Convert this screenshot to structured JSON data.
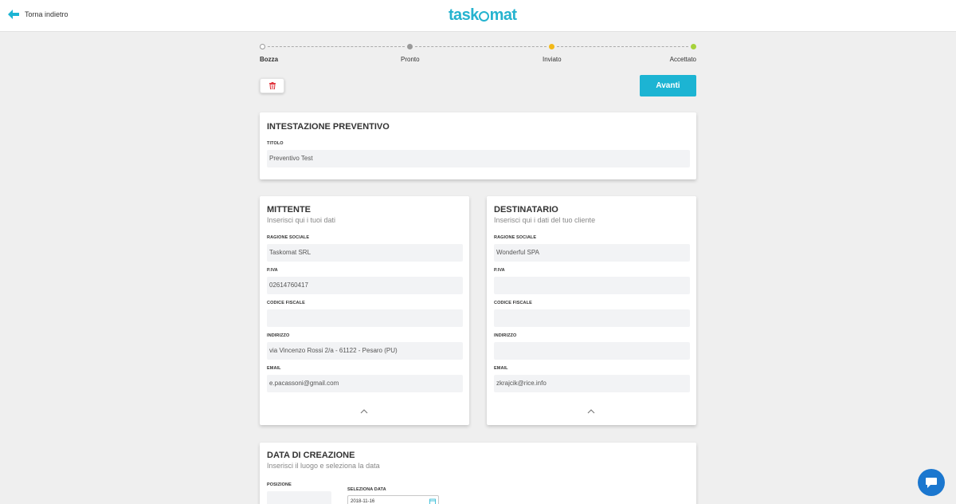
{
  "header": {
    "back_label": "Torna indietro",
    "logo_left": "task",
    "logo_right": "mat"
  },
  "stepper": {
    "steps": [
      "Bozza",
      "Pronto",
      "Inviato",
      "Accettato"
    ],
    "active": "Bozza",
    "colors": [
      "#ffffff",
      "#999999",
      "#f3b918",
      "#a6d23b"
    ]
  },
  "toolbar": {
    "next_label": "Avanti",
    "delete_icon": "trash-icon"
  },
  "intestazione": {
    "title": "INTESTAZIONE PREVENTIVO",
    "field_label": "TITOLO",
    "field_value": "Preventivo Test"
  },
  "mittente": {
    "title": "MITTENTE",
    "subtitle": "Inserisci qui i tuoi dati",
    "fields": [
      {
        "label": "RAGIONE SOCIALE",
        "value": "Taskomat SRL"
      },
      {
        "label": "P.IVA",
        "value": "02614760417"
      },
      {
        "label": "CODICE FISCALE",
        "value": ""
      },
      {
        "label": "INDIRIZZO",
        "value": "via Vincenzo Rossi 2/a - 61122 - Pesaro (PU)"
      },
      {
        "label": "EMAIL",
        "value": "e.pacassoni@gmail.com"
      }
    ]
  },
  "destinatario": {
    "title": "DESTINATARIO",
    "subtitle": "Inserisci qui i dati del tuo cliente",
    "fields": [
      {
        "label": "RAGIONE SOCIALE",
        "value": "Wonderful SPA"
      },
      {
        "label": "P.IVA",
        "value": ""
      },
      {
        "label": "CODICE FISCALE",
        "value": ""
      },
      {
        "label": "INDIRIZZO",
        "value": ""
      },
      {
        "label": "EMAIL",
        "value": "zkrajcik@rice.info"
      }
    ]
  },
  "data_creazione": {
    "title": "DATA DI CREAZIONE",
    "subtitle": "Inserisci il luogo e seleziona la data",
    "position_label": "POSIZIONE",
    "position_value": "",
    "date_label": "SELEZIONA DATA",
    "date_value": "2018-11-16"
  },
  "colors": {
    "accent": "#1cb4d3",
    "chat": "#1b77cf",
    "delete": "#e0343c"
  }
}
